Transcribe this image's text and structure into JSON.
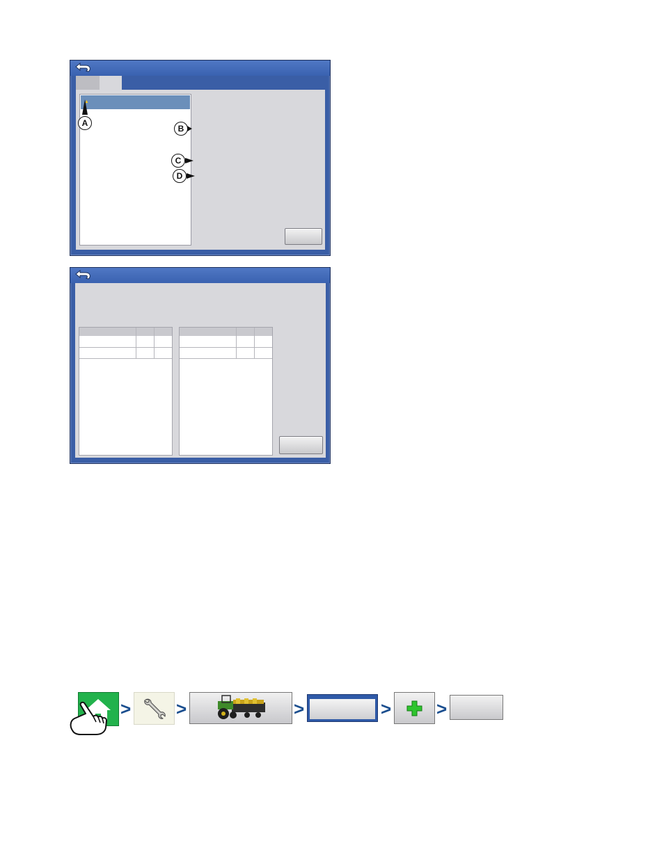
{
  "screen_top": {
    "tabs": [
      "",
      ""
    ],
    "list_selected_text": "",
    "callouts": [
      "A",
      "B",
      "C",
      "D"
    ],
    "button_label": ""
  },
  "screen_bottom": {
    "left_table": {
      "headers": [
        "",
        "",
        ""
      ],
      "rows": [
        [
          "",
          "",
          ""
        ],
        [
          "",
          "",
          ""
        ]
      ]
    },
    "right_table": {
      "headers": [
        "",
        "",
        ""
      ],
      "rows": [
        [
          "",
          "",
          ""
        ],
        [
          "",
          "",
          ""
        ]
      ]
    },
    "button_label": ""
  },
  "nav_path": {
    "steps": [
      "home-button",
      "tools-button",
      "equipment-button",
      "blank-button",
      "add-button",
      "final-button"
    ],
    "chevron": ">",
    "colors": {
      "home": "#22b24c",
      "chevron": "#1b4f8f",
      "tools_bg": "#f4f4e6"
    }
  },
  "colors": {
    "window_blue": "#3a5ea6",
    "panel_gray": "#d8d8dc",
    "selection": "#6b8fba"
  }
}
